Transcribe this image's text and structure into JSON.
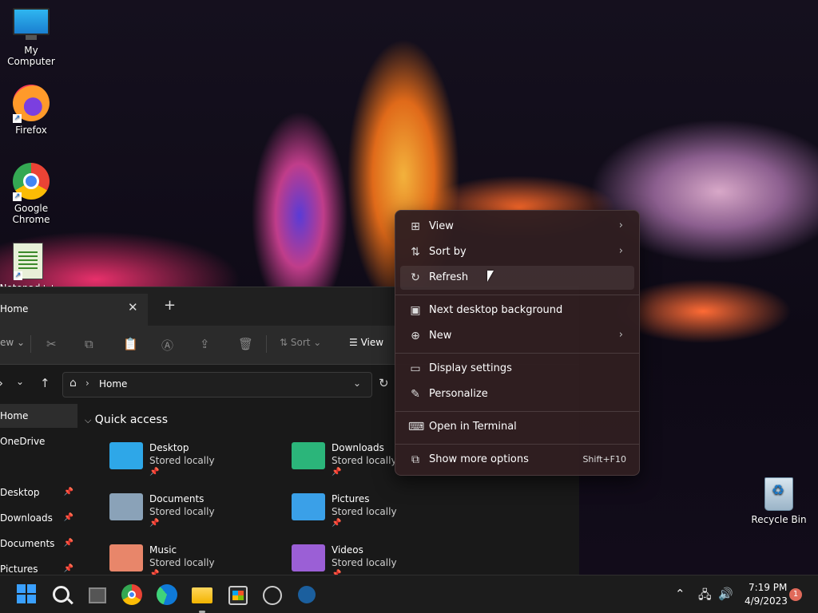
{
  "desktop": {
    "icons": [
      {
        "label": "My Computer"
      },
      {
        "label": "Firefox"
      },
      {
        "label": "Google Chrome"
      },
      {
        "label": "Notepad++"
      },
      {
        "label": "Recycle Bin"
      }
    ]
  },
  "explorer": {
    "tab_title": "Home",
    "tab_close": "✕",
    "tab_add": "+",
    "toolbar": {
      "new_label": "ew",
      "sort_label": "Sort",
      "view_label": "View"
    },
    "address": {
      "label": "Home"
    },
    "sidebar": [
      {
        "label": "Home"
      },
      {
        "label": "OneDrive"
      },
      {
        "label": "Desktop"
      },
      {
        "label": "Downloads"
      },
      {
        "label": "Documents"
      },
      {
        "label": "Pictures"
      }
    ],
    "quick_access_title": "Quick access",
    "folders": [
      {
        "name": "Desktop",
        "sub": "Stored locally",
        "color": "#2ea7e8"
      },
      {
        "name": "Downloads",
        "sub": "Stored locally",
        "color": "#2bb57a"
      },
      {
        "name": "Documents",
        "sub": "Stored locally",
        "color": "#8aa2b8"
      },
      {
        "name": "Pictures",
        "sub": "Stored locally",
        "color": "#3aa0e8"
      },
      {
        "name": "Music",
        "sub": "Stored locally",
        "color": "#e8866a"
      },
      {
        "name": "Videos",
        "sub": "Stored locally",
        "color": "#9b5fd6"
      }
    ]
  },
  "context_menu": {
    "items": [
      {
        "label": "View",
        "icon": "grid-icon"
      },
      {
        "label": "Sort by",
        "icon": "sort-icon"
      },
      {
        "label": "Refresh",
        "icon": "refresh-icon"
      },
      {
        "label": "Next desktop background",
        "icon": "next-background-icon"
      },
      {
        "label": "New",
        "icon": "new-icon"
      },
      {
        "label": "Display settings",
        "icon": "display-icon"
      },
      {
        "label": "Personalize",
        "icon": "brush-icon"
      },
      {
        "label": "Open in Terminal",
        "icon": "terminal-icon"
      },
      {
        "label": "Show more options",
        "icon": "more-options-icon",
        "shortcut": "Shift+F10"
      }
    ]
  },
  "taskbar": {
    "clock_time": "7:19 PM",
    "clock_date": "4/9/2023",
    "notification_count": "1"
  }
}
